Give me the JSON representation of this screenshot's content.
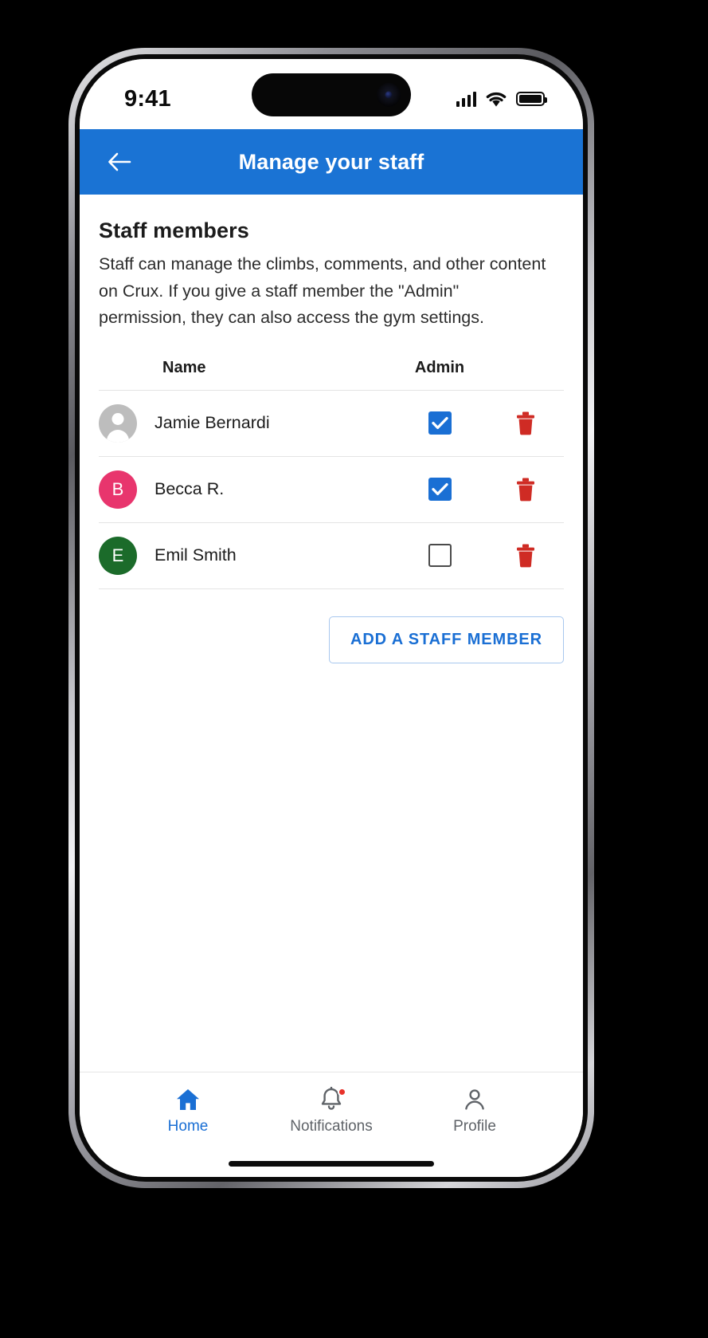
{
  "status_bar": {
    "time": "9:41",
    "signal_icon": "cellular-signal-icon",
    "wifi_icon": "wifi-icon",
    "battery_icon": "battery-icon"
  },
  "app_bar": {
    "back_icon": "back-arrow-icon",
    "title": "Manage your staff",
    "background_color": "#1a73d4",
    "title_color": "#ffffff"
  },
  "content": {
    "section_title": "Staff members",
    "section_description": "Staff can manage the climbs, comments, and other content on Crux. If you give a staff member the \"Admin\" permission, they can also access the gym settings."
  },
  "table": {
    "columns": [
      "Name",
      "Admin"
    ],
    "rows": [
      {
        "name": "Jamie Bernardi",
        "avatar_type": "placeholder",
        "avatar_initial": "",
        "avatar_color": "#bdbdbd",
        "admin": true,
        "delete_icon": "trash-icon"
      },
      {
        "name": "Becca R.",
        "avatar_type": "initial",
        "avatar_initial": "B",
        "avatar_color": "#e8356d",
        "admin": true,
        "delete_icon": "trash-icon"
      },
      {
        "name": "Emil Smith",
        "avatar_type": "initial",
        "avatar_initial": "E",
        "avatar_color": "#1b6b2a",
        "admin": false,
        "delete_icon": "trash-icon"
      }
    ]
  },
  "actions": {
    "add_staff_label": "ADD A STAFF MEMBER"
  },
  "bottom_nav": {
    "items": [
      {
        "label": "Home",
        "icon": "home-icon",
        "active": true,
        "badge": false
      },
      {
        "label": "Notifications",
        "icon": "bell-icon",
        "active": false,
        "badge": true
      },
      {
        "label": "Profile",
        "icon": "person-icon",
        "active": false,
        "badge": false
      }
    ]
  },
  "colors": {
    "accent": "#1a6fd4",
    "app_bar": "#1a73d4",
    "delete": "#cf2b24",
    "divider": "#e4e4e4"
  }
}
